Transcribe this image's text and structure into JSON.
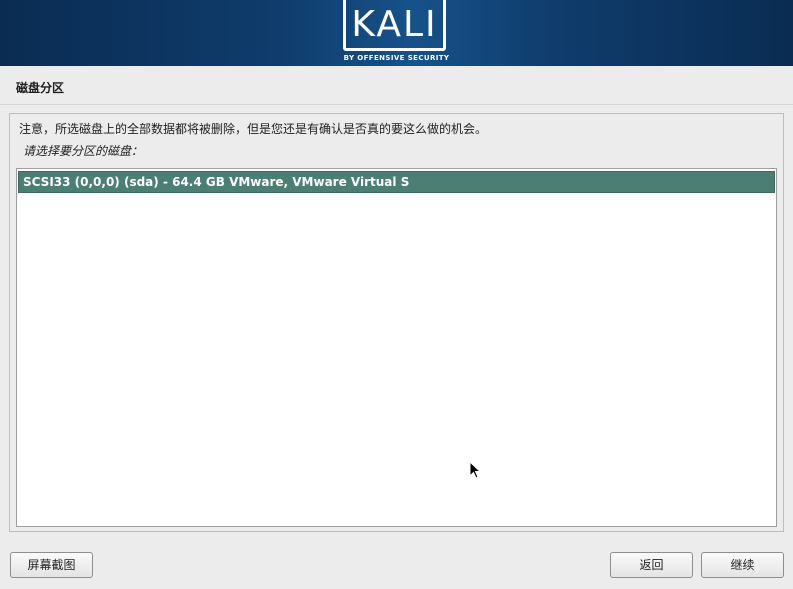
{
  "header": {
    "logo_text": "KALI",
    "logo_subtitle": "BY OFFENSIVE SECURITY",
    "background_color": "#0f3c6c"
  },
  "page": {
    "title": "磁盘分区",
    "warning": "注意，所选磁盘上的全部数据都将被删除，但是您还是有确认是否真的要这么做的机会。",
    "prompt": "请选择要分区的磁盘："
  },
  "disk_list": {
    "items": [
      {
        "label": "SCSI33 (0,0,0) (sda) - 64.4 GB VMware, VMware Virtual S",
        "selected": true
      }
    ],
    "selection_color": "#4b7f73"
  },
  "buttons": {
    "screenshot": "屏幕截图",
    "back": "返回",
    "continue": "继续"
  },
  "cursor": {
    "icon": "arrow-pointer-icon"
  }
}
